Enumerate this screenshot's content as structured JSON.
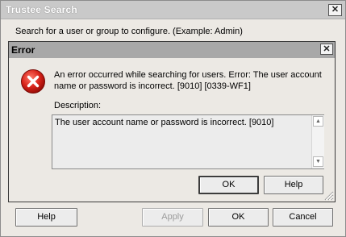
{
  "outer": {
    "title": "Trustee Search",
    "close": "✕",
    "instruction": "Search for a user or group to configure. (Example: Admin)",
    "buttons": {
      "help": "Help",
      "apply": "Apply",
      "ok": "OK",
      "cancel": "Cancel"
    }
  },
  "error_dialog": {
    "title": "Error",
    "close": "✕",
    "icon": "error-icon",
    "message": "An error occurred while searching for users. Error: The user account name or password is incorrect. [9010] [0339-WF1]",
    "description_label": "Description:",
    "description_text": "The user account name or password is incorrect. [9010]",
    "buttons": {
      "ok": "OK",
      "help": "Help"
    }
  }
}
